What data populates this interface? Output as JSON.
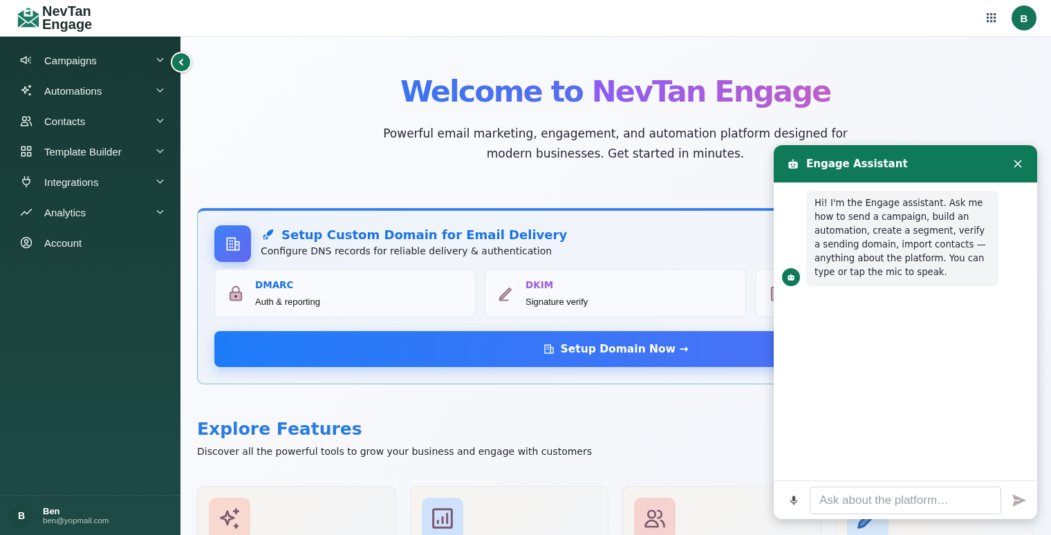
{
  "header": {
    "logo": {
      "line1": "NevTan",
      "line2": "Engage"
    },
    "avatar": "B"
  },
  "sidebar": {
    "items": [
      {
        "label": "Campaigns",
        "expandable": true
      },
      {
        "label": "Automations",
        "expandable": true
      },
      {
        "label": "Contacts",
        "expandable": true
      },
      {
        "label": "Template Builder",
        "expandable": true
      },
      {
        "label": "Integrations",
        "expandable": true
      },
      {
        "label": "Analytics",
        "expandable": true
      },
      {
        "label": "Account",
        "expandable": false
      }
    ],
    "user": {
      "initial": "B",
      "name": "Ben",
      "email": "ben@yopmail.com"
    }
  },
  "hero": {
    "title_start": "Welcome to",
    "title_brand": "NevTan Engage",
    "subtitle": "Powerful email marketing, engagement, and automation platform designed for modern businesses. Get started in minutes."
  },
  "domain_card": {
    "title": "Setup Custom Domain for Email Delivery",
    "description": "Configure DNS records for reliable delivery & authentication",
    "records": [
      {
        "name": "DMARC",
        "detail": "Auth & reporting",
        "color": "#1a73e8"
      },
      {
        "name": "DKIM",
        "detail": "Signature verify",
        "color": "#9b5de5"
      }
    ],
    "button": "Setup Domain Now →"
  },
  "features": {
    "title": "Explore Features",
    "subtitle": "Discover all the powerful tools to grow your business and engage with customers",
    "cards": [
      {
        "color": "#f9d9cf"
      },
      {
        "color": "#cfe2fb"
      },
      {
        "color": "#f6d3d0"
      },
      {
        "color": "#d7e8fb"
      }
    ]
  },
  "assistant": {
    "title": "Engage Assistant",
    "message": "Hi! I'm the Engage assistant. Ask me how to send a campaign, build an automation, create a segment, verify a sending domain, import contacts — anything about the platform. You can type or tap the mic to speak.",
    "placeholder": "Ask about the platform…"
  }
}
